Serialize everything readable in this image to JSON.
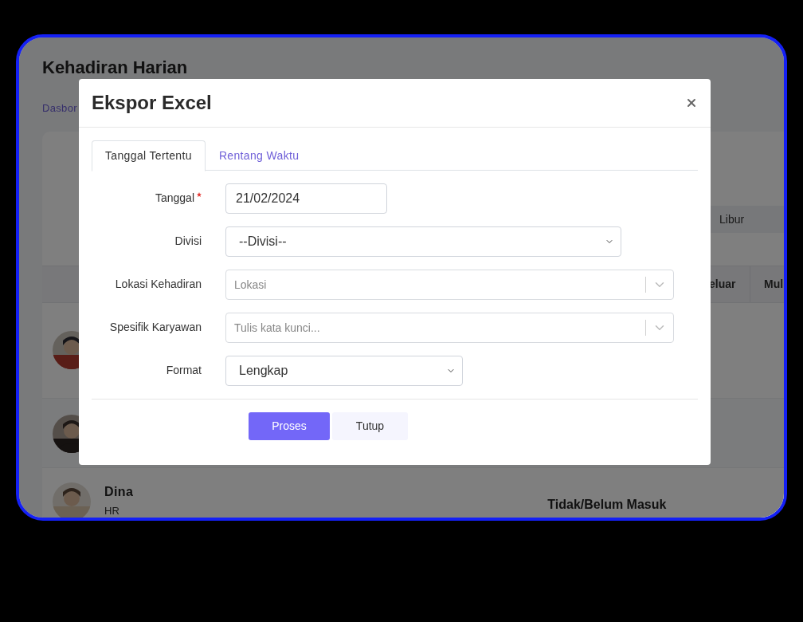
{
  "page": {
    "title": "Kehadiran Harian",
    "breadcrumb": "Dasbor"
  },
  "filter_chip": "Libur",
  "table": {
    "columns": [
      "eluar",
      "Mul"
    ],
    "rows": [
      {
        "avatar": {
          "kind": "picture"
        }
      },
      {
        "avatar": {
          "kind": "picture"
        }
      },
      {
        "avatar": {
          "kind": "picture"
        },
        "name": "Dina",
        "role": "HR",
        "status": "Tidak/Belum Masuk"
      }
    ]
  },
  "modal": {
    "title": "Ekspor Excel",
    "tabs": [
      {
        "label": "Tanggal Tertentu",
        "selected": true
      },
      {
        "label": "Rentang Waktu",
        "selected": false
      }
    ],
    "fields": [
      {
        "kind": "date",
        "label": "Tanggal",
        "required": true,
        "value": "21/02/2024"
      },
      {
        "kind": "select",
        "label": "Divisi",
        "required": false,
        "value": "--Divisi--"
      },
      {
        "kind": "combo",
        "label": "Lokasi Kehadiran",
        "required": false,
        "placeholder": "Lokasi"
      },
      {
        "kind": "combo",
        "label": "Spesifik Karyawan",
        "required": false,
        "placeholder": "Tulis kata kunci..."
      },
      {
        "kind": "select",
        "label": "Format",
        "required": false,
        "value": "Lengkap"
      }
    ],
    "buttons": [
      {
        "kind": "primary",
        "label": "Proses"
      },
      {
        "kind": "secondary",
        "label": "Tutup"
      }
    ]
  }
}
